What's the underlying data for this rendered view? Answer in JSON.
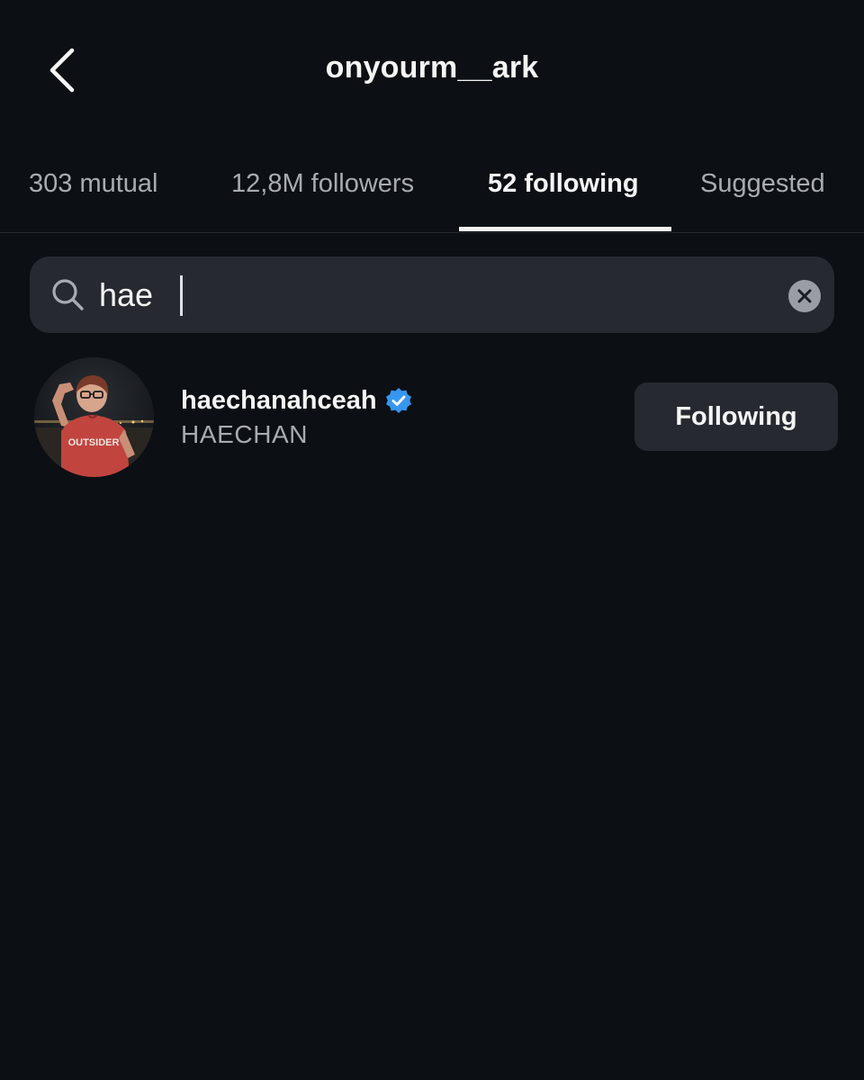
{
  "header": {
    "title": "onyourm__ark",
    "back_icon": "chevron-left-icon"
  },
  "tabs": [
    {
      "label": "303 mutual",
      "active": false
    },
    {
      "label": "12,8M followers",
      "active": false
    },
    {
      "label": "52 following",
      "active": true
    },
    {
      "label": "Suggested",
      "active": false
    }
  ],
  "search": {
    "value": "hae",
    "icon": "search-icon",
    "clear_icon": "clear-icon"
  },
  "results": [
    {
      "username": "haechanahceah",
      "full_name": "HAECHAN",
      "verified": true,
      "button_label": "Following",
      "avatar_shirt_text": "OUTSIDER"
    }
  ],
  "colors": {
    "background": "#0c1014",
    "text_primary": "#f5f5f5",
    "text_secondary": "#a8acb2",
    "surface": "#262a30",
    "verified_blue": "#3797f0"
  }
}
